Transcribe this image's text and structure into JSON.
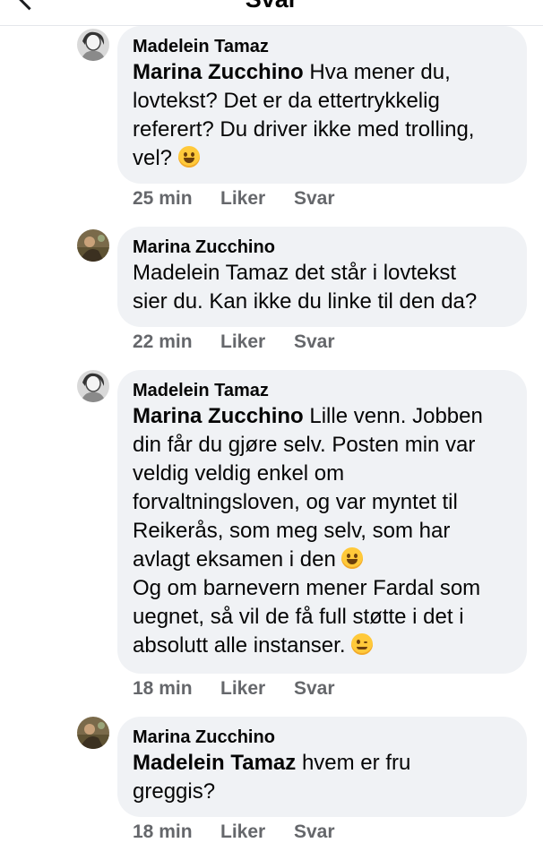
{
  "header": {
    "title": "Svar"
  },
  "comments": [
    {
      "author": "Madelein Tamaz",
      "lines": [
        [
          {
            "t": "Marina Zucchino",
            "b": true
          },
          {
            "t": " Hva mener du,"
          }
        ],
        [
          {
            "t": "lovtekst? Det er da ettertrykkelig"
          }
        ],
        [
          {
            "t": "referert? Du driver ikke med trolling,"
          }
        ],
        [
          {
            "t": "vel? "
          },
          {
            "emoji": "grinning-sweat-emoji"
          }
        ]
      ],
      "time": "25 min",
      "like": "Liker",
      "reply": "Svar"
    },
    {
      "author": "Marina Zucchino",
      "lines": [
        [
          {
            "t": "Madelein Tamaz det står i lovtekst"
          }
        ],
        [
          {
            "t": "sier du. Kan ikke du linke til den da?"
          }
        ]
      ],
      "time": "22 min",
      "like": "Liker",
      "reply": "Svar"
    },
    {
      "author": "Madelein Tamaz",
      "lines": [
        [
          {
            "t": "Marina Zucchino",
            "b": true
          },
          {
            "t": " Lille venn. Jobben"
          }
        ],
        [
          {
            "t": "din får du gjøre selv. Posten min var"
          }
        ],
        [
          {
            "t": "veldig veldig enkel om"
          }
        ],
        [
          {
            "t": "forvaltningsloven, og var myntet til"
          }
        ],
        [
          {
            "t": "Reikerås, som meg selv, som har"
          }
        ],
        [
          {
            "t": "avlagt eksamen i den "
          },
          {
            "emoji": "smiley-emoji"
          }
        ],
        [
          {
            "t": "Og om barnevern mener Fardal som"
          }
        ],
        [
          {
            "t": "uegnet, så vil de få full støtte i det i"
          }
        ],
        [
          {
            "t": "absolutt alle instanser. "
          },
          {
            "emoji": "wink-emoji"
          }
        ]
      ],
      "time": "18 min",
      "like": "Liker",
      "reply": "Svar"
    },
    {
      "author": "Marina Zucchino",
      "lines": [
        [
          {
            "t": "Madelein Tamaz",
            "b": true
          },
          {
            "t": " hvem er fru"
          }
        ],
        [
          {
            "t": "greggis?"
          }
        ]
      ],
      "time": "18 min",
      "like": "Liker",
      "reply": "Svar"
    }
  ],
  "avatars": {
    "madelein": "sketch-portrait-avatar",
    "marina": "outdoor-photo-avatar"
  },
  "colors": {
    "bubble": "#f0f2f5",
    "meta": "#65676b",
    "text": "#050505"
  }
}
